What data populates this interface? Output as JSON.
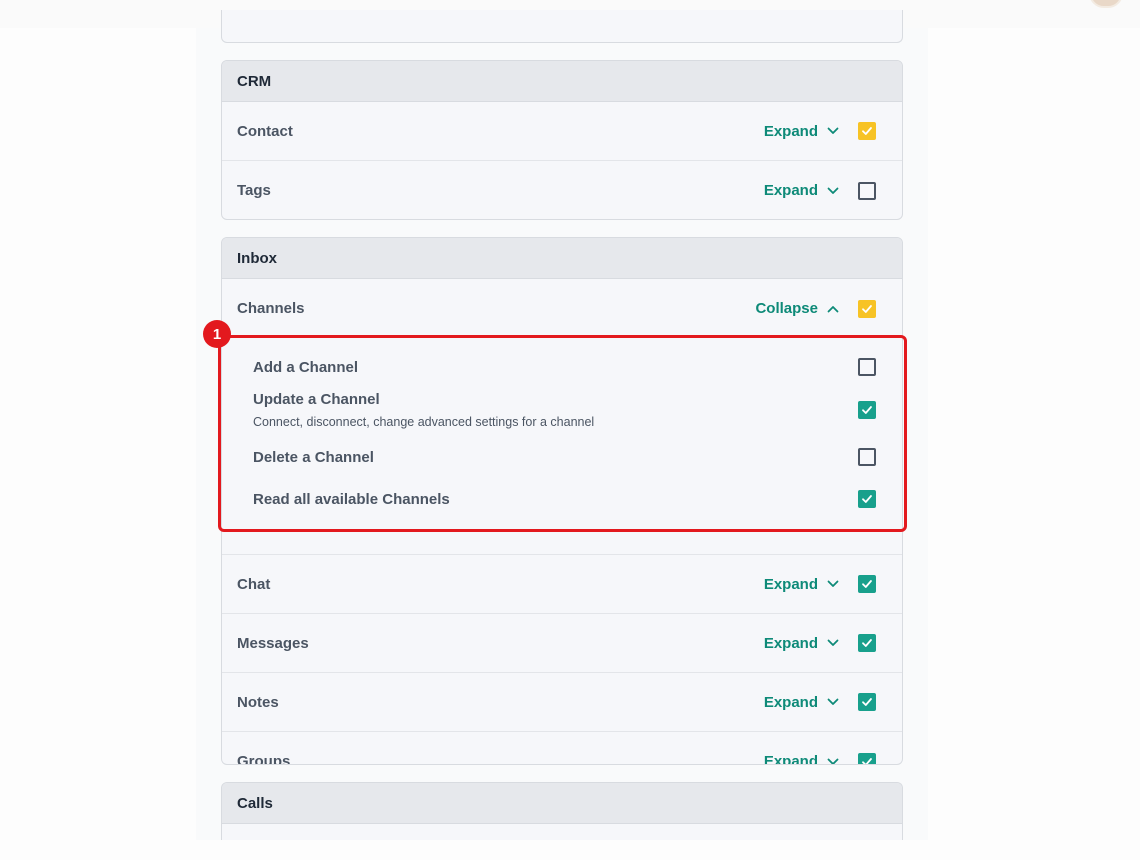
{
  "marker": "1",
  "sections": {
    "crm": {
      "title": "CRM",
      "rows": [
        {
          "label": "Contact",
          "toggle": "Expand",
          "checked": true,
          "check_color": "yellow"
        },
        {
          "label": "Tags",
          "toggle": "Expand",
          "checked": false
        }
      ]
    },
    "inbox": {
      "title": "Inbox",
      "channels": {
        "label": "Channels",
        "toggle": "Collapse",
        "checked": true,
        "check_color": "yellow"
      },
      "channel_permissions": [
        {
          "label": "Add a Channel",
          "checked": false
        },
        {
          "label": "Update a Channel",
          "description": "Connect, disconnect, change advanced settings for a channel",
          "checked": true
        },
        {
          "label": "Delete a Channel",
          "checked": false
        },
        {
          "label": "Read all available Channels",
          "checked": true
        }
      ],
      "rows": [
        {
          "label": "Chat",
          "toggle": "Expand",
          "checked": true
        },
        {
          "label": "Messages",
          "toggle": "Expand",
          "checked": true
        },
        {
          "label": "Notes",
          "toggle": "Expand",
          "checked": true
        },
        {
          "label": "Groups",
          "toggle": "Expand",
          "checked": true
        }
      ]
    },
    "calls": {
      "title": "Calls"
    }
  },
  "colors": {
    "accent_teal": "#18a08c",
    "toggle_text": "#0e8a78",
    "partial_yellow": "#f7c325",
    "highlight_red": "#e3191e"
  }
}
